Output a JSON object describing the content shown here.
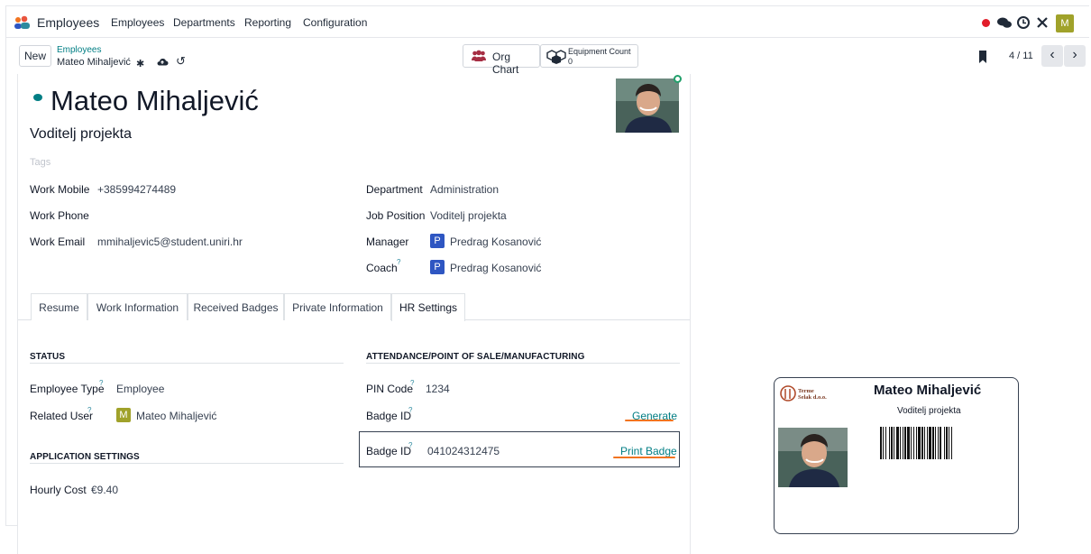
{
  "colors": {
    "accent": "#017e84",
    "orange": "#f27420",
    "avatar": "#a0a22a",
    "manager": "#2e56c2",
    "teal": "#2d8a9f"
  },
  "navbar": {
    "app_name": "Employees",
    "menu": [
      "Employees",
      "Departments",
      "Reporting",
      "Configuration"
    ],
    "user_initial": "M"
  },
  "control": {
    "new_label": "New",
    "breadcrumb_parent": "Employees",
    "record_name": "Mateo Mihaljević",
    "org_chart_label": "Org Chart",
    "equipment_label": "Equipment Count",
    "equipment_count": "0",
    "pager": "4 / 11"
  },
  "employee": {
    "name": "Mateo Mihaljević",
    "job_title": "Voditelj projekta",
    "tags_placeholder": "Tags"
  },
  "fields_left": [
    {
      "label": "Work Mobile",
      "value": "+385994274489"
    },
    {
      "label": "Work Phone",
      "value": ""
    },
    {
      "label": "Work Email",
      "value": "mmihaljevic5@student.uniri.hr"
    }
  ],
  "fields_right": {
    "department_label": "Department",
    "department": "Administration",
    "job_position_label": "Job Position",
    "job_position": "Voditelj projekta",
    "manager_label": "Manager",
    "manager": "Predrag Kosanović",
    "manager_initial": "P",
    "coach_label": "Coach",
    "coach": "Predrag Kosanović",
    "coach_initial": "P",
    "help": "?"
  },
  "tabs": [
    "Resume",
    "Work Information",
    "Received Badges",
    "Private Information",
    "HR Settings"
  ],
  "hr": {
    "status_title": "STATUS",
    "employee_type_label": "Employee Type",
    "employee_type": "Employee",
    "related_user_label": "Related User",
    "related_user": "Mateo Mihaljević",
    "related_user_initial": "M",
    "app_settings_title": "APPLICATION SETTINGS",
    "hourly_cost_label": "Hourly Cost",
    "hourly_cost": "€9.40",
    "attendance_title": "ATTENDANCE/POINT OF SALE/MANUFACTURING",
    "pin_label": "PIN Code",
    "pin": "1234",
    "badge_label": "Badge ID",
    "generate": "Generate",
    "badge_label_2": "Badge ID",
    "badge_id": "041024312475",
    "print_badge": "Print Badge",
    "help": "?"
  },
  "badge_card": {
    "name": "Mateo Mihaljević",
    "title": "Voditelj projekta",
    "logo_text": "Terme Selak d.o.o."
  }
}
